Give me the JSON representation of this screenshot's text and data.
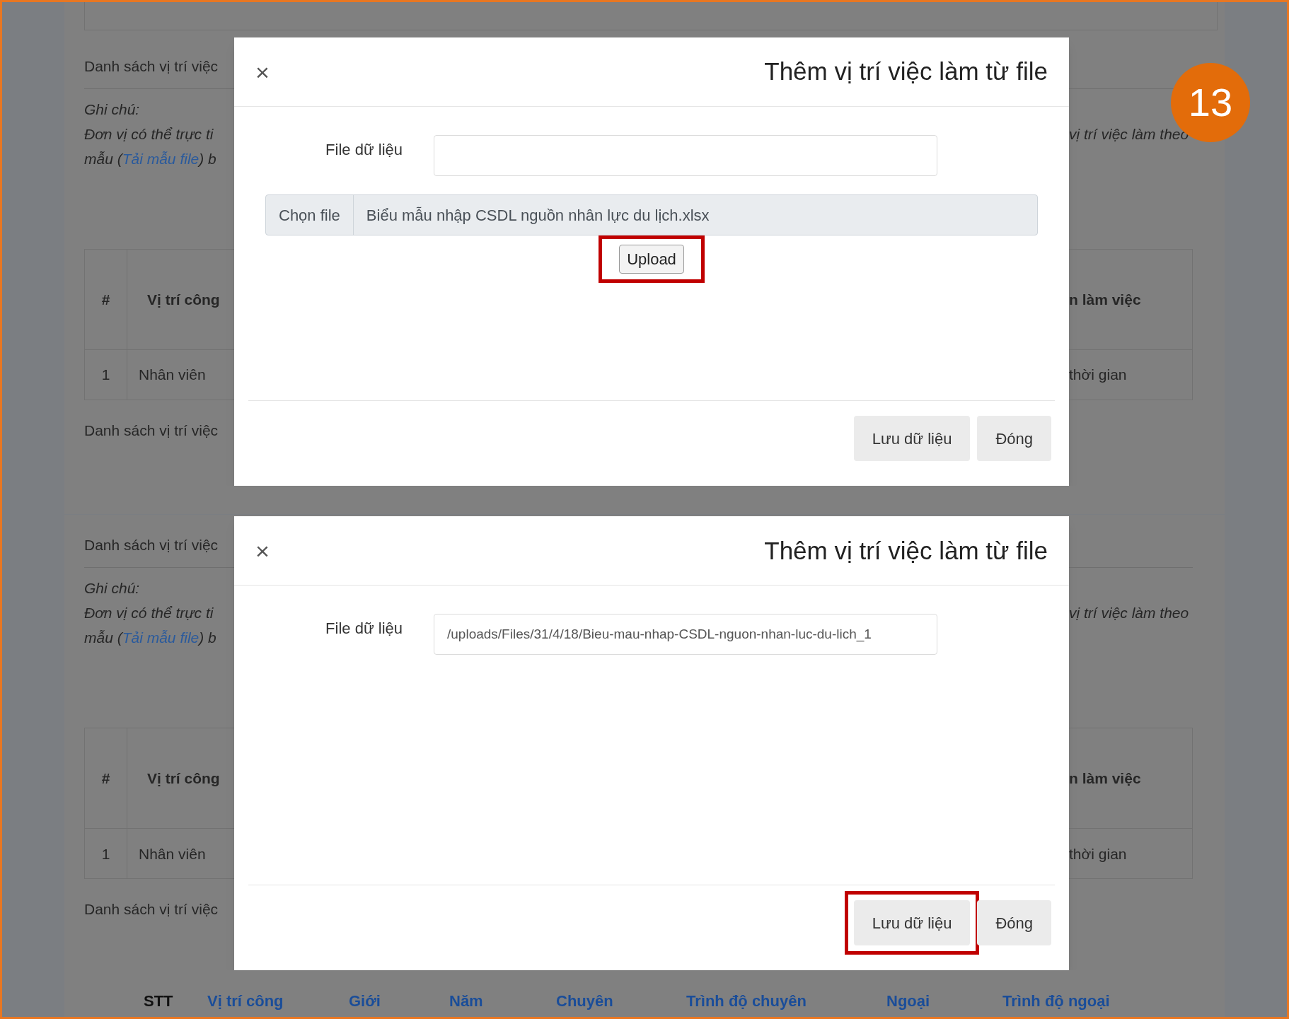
{
  "step_badge": "13",
  "panels": [
    {
      "background": {
        "heading": "Danh sách vị trí việc",
        "note_label": "Ghi chú:",
        "note_line_1": "Đơn vị có thể trực ti",
        "note_line_2": {
          "before": "mẫu (",
          "link": "Tải mẫu file",
          "after": ") b"
        },
        "note_line_right": "vị trí việc làm theo",
        "table_header": [
          "#",
          "Vị trí công"
        ],
        "table_header_right": "n làm việc",
        "table_row": [
          "1",
          "Nhân viên"
        ],
        "table_row_right": "thời gian",
        "heading_2": "Danh sách vị trí việc"
      },
      "modal": {
        "close": "×",
        "title": "Thêm vị trí việc làm từ file",
        "field_label": "File dữ liệu",
        "file_picker": {
          "button": "Chọn file",
          "filename": "Biểu mẫu nhập CSDL nguồn nhân lực du lịch.xlsx"
        },
        "upload": {
          "label": "Upload",
          "highlighted": true
        },
        "footer_buttons": [
          {
            "label": "Lưu dữ liệu",
            "highlighted": false
          },
          {
            "label": "Đóng",
            "highlighted": false
          }
        ]
      }
    },
    {
      "background": {
        "heading": "Danh sách vị trí việc",
        "note_label": "Ghi chú:",
        "note_line_1": "Đơn vị có thể trực ti",
        "note_line_2": {
          "before": "mẫu (",
          "link": "Tải mẫu file",
          "after": ") b"
        },
        "note_line_right": "vị trí việc làm theo",
        "table_header": [
          "#",
          "Vị trí công"
        ],
        "table_header_right": "n làm việc",
        "table_row": [
          "1",
          "Nhân viên"
        ],
        "table_row_right": "thời gian",
        "heading_2": "Danh sách vị trí việc",
        "list_columns": [
          "STT",
          "Vị trí công",
          "Giới",
          "Năm",
          "Chuyên",
          "Trình độ chuyên",
          "Ngoại",
          "Trình độ ngoại"
        ]
      },
      "modal": {
        "close": "×",
        "title": "Thêm vị trí việc làm từ file",
        "field_label": "File dữ liệu",
        "field_value": "/uploads/Files/31/4/18/Bieu-mau-nhap-CSDL-nguon-nhan-luc-du-lich_1",
        "footer_buttons": [
          {
            "label": "Lưu dữ liệu",
            "highlighted": true
          },
          {
            "label": "Đóng",
            "highlighted": false
          }
        ]
      }
    }
  ]
}
